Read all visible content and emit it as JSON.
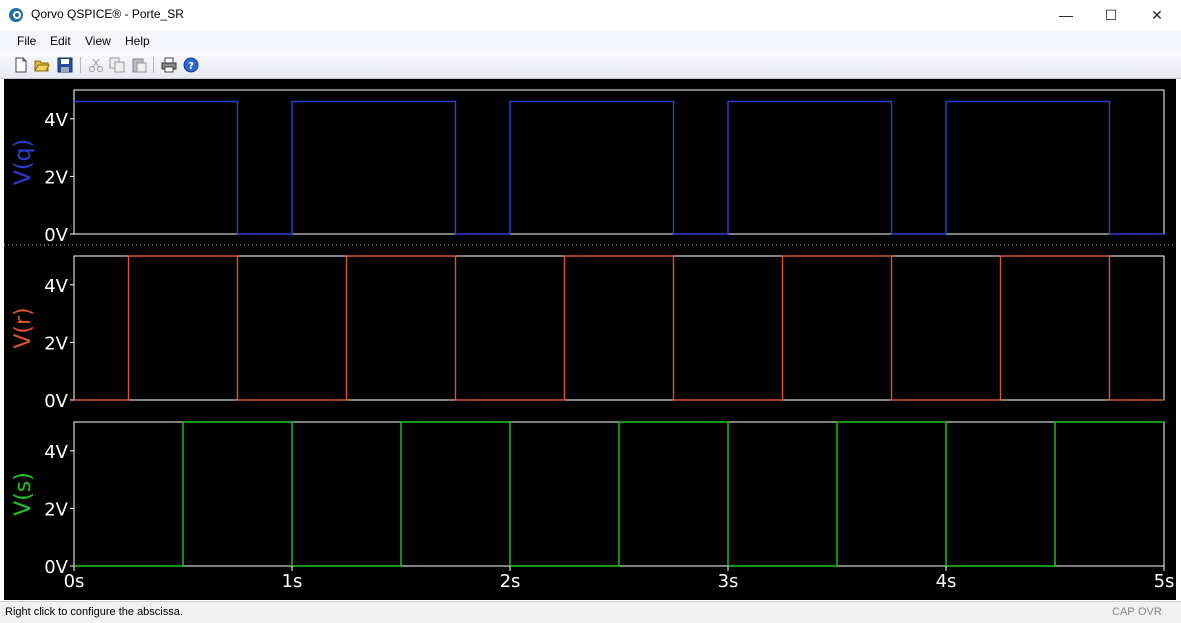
{
  "window": {
    "title": "Qorvo QSPICE® - Porte_SR",
    "minimize": "—",
    "maximize": "☐",
    "close": "✕"
  },
  "menu": [
    "File",
    "Edit",
    "View",
    "Help"
  ],
  "toolbar_icons": [
    "new-file-icon",
    "open-folder-icon",
    "save-icon",
    "cut-icon",
    "copy-icon",
    "paste-icon",
    "print-icon",
    "help-icon"
  ],
  "status": {
    "message": "Right click to configure the abscissa.",
    "cap": "CAP",
    "ovr": "OVR"
  },
  "colors": {
    "q": "#2a3fd6",
    "r": "#e0542a",
    "s": "#1ec81e",
    "axis": "#ffffff",
    "background": "#000000"
  },
  "chart_data": {
    "type": "line",
    "x_unit": "s",
    "xlim": [
      0,
      5
    ],
    "x_ticks": [
      "0s",
      "1s",
      "2s",
      "3s",
      "4s",
      "5s"
    ],
    "ylim": [
      0,
      5
    ],
    "y_ticks": [
      "0V",
      "2V",
      "4V"
    ],
    "panes": [
      {
        "name": "V(q)",
        "color": "#2a3fd6",
        "points": [
          [
            0,
            4.6
          ],
          [
            0.75,
            4.6
          ],
          [
            0.75,
            0
          ],
          [
            1.0,
            0
          ],
          [
            1.0,
            4.6
          ],
          [
            1.75,
            4.6
          ],
          [
            1.75,
            0
          ],
          [
            2.0,
            0
          ],
          [
            2.0,
            4.6
          ],
          [
            2.75,
            4.6
          ],
          [
            2.75,
            0
          ],
          [
            3.0,
            0
          ],
          [
            3.0,
            4.6
          ],
          [
            3.75,
            4.6
          ],
          [
            3.75,
            0
          ],
          [
            4.0,
            0
          ],
          [
            4.0,
            4.6
          ],
          [
            4.75,
            4.6
          ],
          [
            4.75,
            0
          ],
          [
            5.0,
            0
          ]
        ]
      },
      {
        "name": "V(r)",
        "color": "#e0542a",
        "points": [
          [
            0,
            0
          ],
          [
            0.25,
            0
          ],
          [
            0.25,
            5
          ],
          [
            0.75,
            5
          ],
          [
            0.75,
            0
          ],
          [
            1.25,
            0
          ],
          [
            1.25,
            5
          ],
          [
            1.75,
            5
          ],
          [
            1.75,
            0
          ],
          [
            2.25,
            0
          ],
          [
            2.25,
            5
          ],
          [
            2.75,
            5
          ],
          [
            2.75,
            0
          ],
          [
            3.25,
            0
          ],
          [
            3.25,
            5
          ],
          [
            3.75,
            5
          ],
          [
            3.75,
            0
          ],
          [
            4.25,
            0
          ],
          [
            4.25,
            5
          ],
          [
            4.75,
            5
          ],
          [
            4.75,
            0
          ],
          [
            5.0,
            0
          ]
        ]
      },
      {
        "name": "V(s)",
        "color": "#1ec81e",
        "points": [
          [
            0,
            0
          ],
          [
            0.5,
            0
          ],
          [
            0.5,
            5
          ],
          [
            1.0,
            5
          ],
          [
            1.0,
            0
          ],
          [
            1.5,
            0
          ],
          [
            1.5,
            5
          ],
          [
            2.0,
            5
          ],
          [
            2.0,
            0
          ],
          [
            2.5,
            0
          ],
          [
            2.5,
            5
          ],
          [
            3.0,
            5
          ],
          [
            3.0,
            0
          ],
          [
            3.5,
            0
          ],
          [
            3.5,
            5
          ],
          [
            4.0,
            5
          ],
          [
            4.0,
            0
          ],
          [
            4.5,
            0
          ],
          [
            4.5,
            5
          ],
          [
            5.0,
            5
          ]
        ]
      }
    ]
  }
}
